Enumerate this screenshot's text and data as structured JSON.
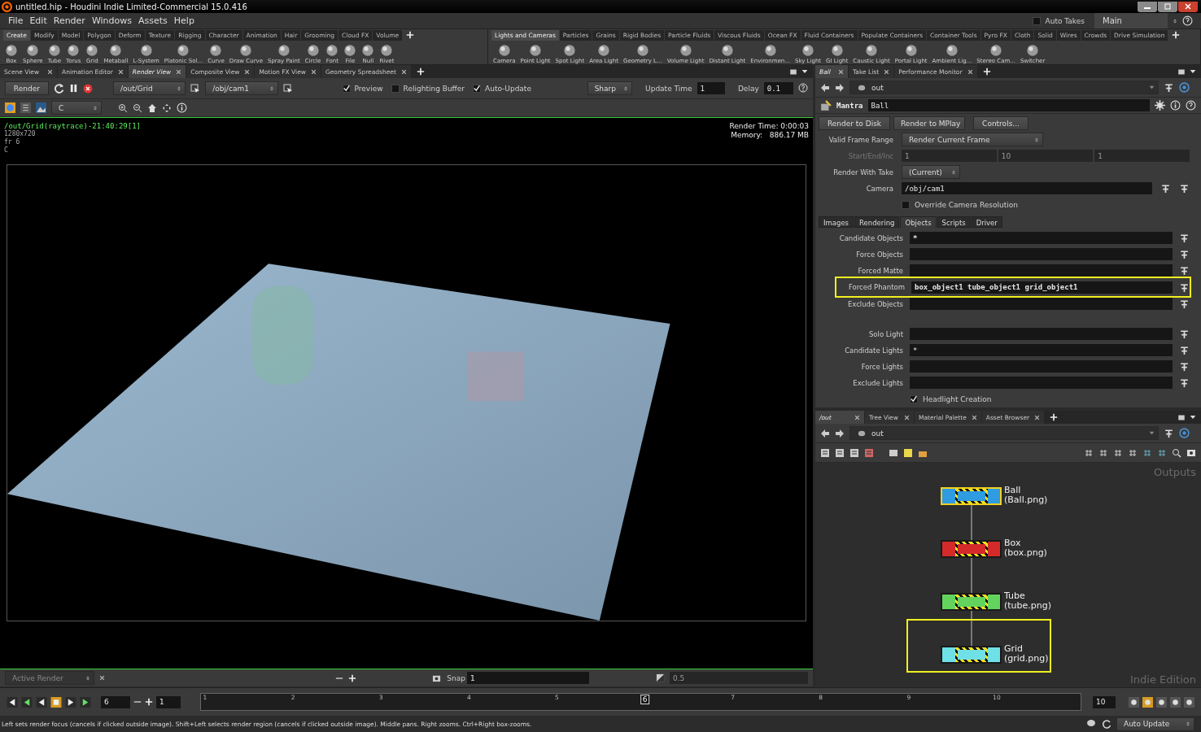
{
  "window": {
    "title": "untitled.hip - Houdini Indie Limited-Commercial 15.0.416"
  },
  "menu": [
    "File",
    "Edit",
    "Render",
    "Windows",
    "Assets",
    "Help"
  ],
  "auto_takes": {
    "label": "Auto Takes",
    "checked": false
  },
  "take": "Main",
  "shelves": [
    {
      "tabs": [
        {
          "label": "Create",
          "selected": true
        },
        {
          "label": "Modify",
          "selected": false
        },
        {
          "label": "Model",
          "selected": false
        },
        {
          "label": "Polygon",
          "selected": false
        },
        {
          "label": "Deform",
          "selected": false
        },
        {
          "label": "Texture",
          "selected": false
        },
        {
          "label": "Rigging",
          "selected": false
        },
        {
          "label": "Character",
          "selected": false
        },
        {
          "label": "Animation",
          "selected": false
        },
        {
          "label": "Hair",
          "selected": false
        },
        {
          "label": "Grooming",
          "selected": false
        },
        {
          "label": "Cloud FX",
          "selected": false
        },
        {
          "label": "Volume",
          "selected": false
        }
      ],
      "tools": [
        "Box",
        "Sphere",
        "Tube",
        "Torus",
        "Grid",
        "Metaball",
        "L-System",
        "Platonic Sol...",
        "Curve",
        "Draw Curve",
        "Spray Paint",
        "Circle",
        "Font",
        "File",
        "Null",
        "Rivet"
      ]
    },
    {
      "tabs": [
        {
          "label": "Lights and Cameras",
          "selected": true
        },
        {
          "label": "Particles",
          "selected": false
        },
        {
          "label": "Grains",
          "selected": false
        },
        {
          "label": "Rigid Bodies",
          "selected": false
        },
        {
          "label": "Particle Fluids",
          "selected": false
        },
        {
          "label": "Viscous Fluids",
          "selected": false
        },
        {
          "label": "Ocean FX",
          "selected": false
        },
        {
          "label": "Fluid Containers",
          "selected": false
        },
        {
          "label": "Populate Containers",
          "selected": false
        },
        {
          "label": "Container Tools",
          "selected": false
        },
        {
          "label": "Pyro FX",
          "selected": false
        },
        {
          "label": "Cloth",
          "selected": false
        },
        {
          "label": "Solid",
          "selected": false
        },
        {
          "label": "Wires",
          "selected": false
        },
        {
          "label": "Crowds",
          "selected": false
        },
        {
          "label": "Drive Simulation",
          "selected": false
        }
      ],
      "tools": [
        "Camera",
        "Point Light",
        "Spot Light",
        "Area Light",
        "Geometry L...",
        "Volume Light",
        "Distant Light",
        "Environmen...",
        "Sky Light",
        "GI Light",
        "Caustic Light",
        "Portal Light",
        "Ambient Lig...",
        "Stereo Cam...",
        "Switcher"
      ]
    }
  ],
  "render_pane": {
    "tabs": [
      {
        "label": "Scene View",
        "selected": false
      },
      {
        "label": "Animation Editor",
        "selected": false
      },
      {
        "label": "Render View",
        "selected": true
      },
      {
        "label": "Composite View",
        "selected": false
      },
      {
        "label": "Motion FX View",
        "selected": false
      },
      {
        "label": "Geometry Spreadsheet",
        "selected": false
      }
    ],
    "render_button": "Render",
    "rop": "/out/Grid",
    "camera": "/obj/cam1",
    "options": [
      {
        "label": "Preview",
        "checked": true
      },
      {
        "label": "Relighting Buffer",
        "checked": false
      },
      {
        "label": "Auto-Update",
        "checked": true
      }
    ],
    "filter": "Sharp",
    "update_time": {
      "label": "Update Time",
      "value": "1"
    },
    "delay": {
      "label": "Delay",
      "value": "0.1"
    },
    "channel": "C",
    "info": [
      "/out/Grid(raytrace)-21:40:29[1]",
      "1280x720",
      "fr 6",
      "C"
    ],
    "render_time": "Render Time: 0:00:03",
    "memory": "Memory:   886.17 MB",
    "active_render": "Active Render",
    "snap": {
      "label": "Snap",
      "value": "1"
    },
    "exposure": "0.5"
  },
  "timeline": {
    "frame": "6",
    "start": "1",
    "end": "10",
    "ticks": [
      {
        "label": "1",
        "selected": false
      },
      {
        "label": "2",
        "selected": false
      },
      {
        "label": "3",
        "selected": false
      },
      {
        "label": "4",
        "selected": false
      },
      {
        "label": "5",
        "selected": false
      },
      {
        "label": "6",
        "selected": true
      },
      {
        "label": "7",
        "selected": false
      },
      {
        "label": "8",
        "selected": false
      },
      {
        "label": "9",
        "selected": false
      },
      {
        "label": "10",
        "selected": false
      }
    ]
  },
  "status_bar": {
    "message": "Left sets render focus (cancels if clicked outside image). Shift+Left selects render region (cancels if clicked outside image). Middle pans. Right zooms. Ctrl+Right box-zooms.",
    "update_mode": "Auto Update"
  },
  "parameter_pane": {
    "tabs": [
      {
        "label": "Ball",
        "selected": true
      },
      {
        "label": "Take List",
        "selected": false
      },
      {
        "label": "Performance Monitor",
        "selected": false
      }
    ],
    "path": "out",
    "node_type": "Mantra",
    "node_name": "Ball",
    "buttons": [
      "Render to Disk",
      "Render to MPlay",
      "Controls..."
    ],
    "valid_frame_range": {
      "label": "Valid Frame Range",
      "value": "Render Current Frame"
    },
    "start_end_inc": {
      "label": "Start/End/Inc",
      "values": [
        "1",
        "10",
        "1"
      ],
      "disabled": true
    },
    "render_with_take": {
      "label": "Render With Take",
      "value": "(Current)"
    },
    "camera": {
      "label": "Camera",
      "value": "/obj/cam1"
    },
    "override_resolution": {
      "label": "Override Camera Resolution",
      "checked": false
    },
    "tabs_2": [
      {
        "label": "Images",
        "selected": false
      },
      {
        "label": "Rendering",
        "selected": false
      },
      {
        "label": "Objects",
        "selected": true
      },
      {
        "label": "Scripts",
        "selected": false
      },
      {
        "label": "Driver",
        "selected": false
      }
    ],
    "object_fields": [
      {
        "label": "Candidate Objects",
        "value": "*",
        "highlighted": false
      },
      {
        "label": "Force Objects",
        "highlighted": false
      },
      {
        "label": "Forced Matte",
        "highlighted": false
      },
      {
        "label": "Forced Phantom",
        "value": "box_object1 tube_object1 grid_object1",
        "highlighted": true
      },
      {
        "label": "Exclude Objects",
        "highlighted": false
      }
    ],
    "light_fields": [
      {
        "label": "Solo Light"
      },
      {
        "label": "Candidate Lights",
        "value": "*"
      },
      {
        "label": "Force Lights"
      },
      {
        "label": "Exclude Lights"
      }
    ],
    "headlight": {
      "label": "Headlight Creation",
      "checked": true
    }
  },
  "network_pane": {
    "tabs": [
      {
        "label": "/out",
        "selected": true
      },
      {
        "label": "Tree View",
        "selected": false
      },
      {
        "label": "Material Palette",
        "selected": false
      },
      {
        "label": "Asset Browser",
        "selected": false
      }
    ],
    "path": "out",
    "context_label": "Outputs",
    "edition_label": "Indie Edition",
    "nodes": [
      {
        "name": "Ball",
        "file": "(Ball.png)",
        "color": "#2f9be0",
        "selected": true,
        "highlighted": false
      },
      {
        "name": "Box",
        "file": "(box.png)",
        "color": "#d42a2a",
        "selected": false,
        "highlighted": false
      },
      {
        "name": "Tube",
        "file": "(tube.png)",
        "color": "#62d45e",
        "selected": false,
        "highlighted": false
      },
      {
        "name": "Grid",
        "file": "(grid.png)",
        "color": "#6ee0e6",
        "selected": false,
        "highlighted": true
      }
    ]
  }
}
